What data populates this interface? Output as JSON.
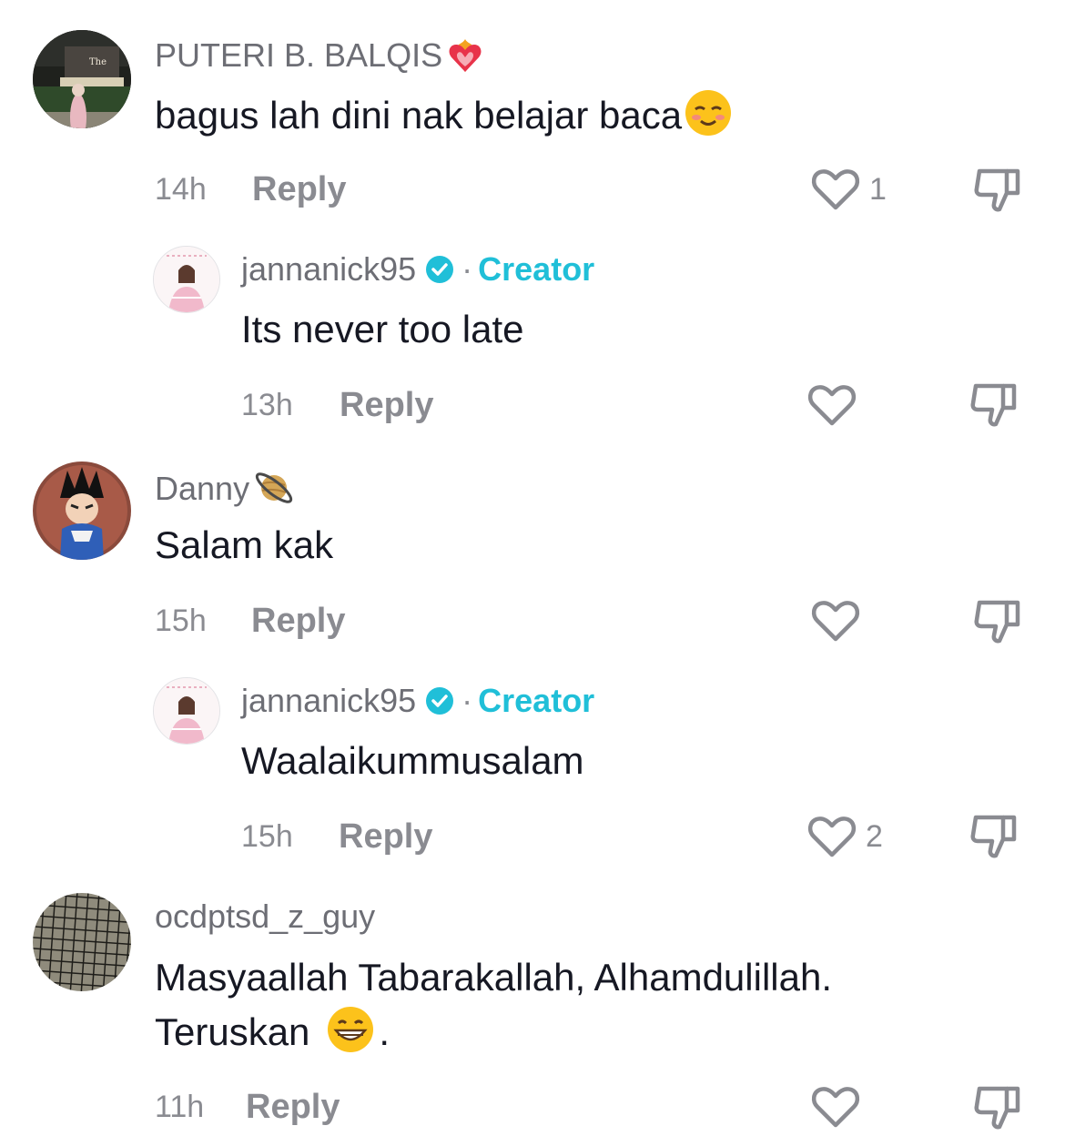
{
  "comments": [
    {
      "username": "PUTERI B. BALQIS",
      "username_emoji": "heart-on-fire-emoji",
      "text": "bagus lah dini nak belajar baca",
      "text_emoji": "smiling-face-emoji",
      "time": "14h",
      "reply_label": "Reply",
      "like_count": "1",
      "reply": {
        "username": "jannanick95",
        "separator": "·",
        "badge": "Creator",
        "text": "Its never too late",
        "time": "13h",
        "reply_label": "Reply",
        "like_count": ""
      }
    },
    {
      "username": "Danny",
      "username_emoji": "ringed-planet-emoji",
      "text": "Salam kak",
      "time": "15h",
      "reply_label": "Reply",
      "like_count": "",
      "reply": {
        "username": "jannanick95",
        "separator": "·",
        "badge": "Creator",
        "text": "Waalaikummusalam",
        "time": "15h",
        "reply_label": "Reply",
        "like_count": "2"
      }
    },
    {
      "username": "ocdptsd_z_guy",
      "text_line1": "Masyaallah Tabarakallah, Alhamdulillah.",
      "text_line2": "Teruskan",
      "text_line2_suffix": ".",
      "text_emoji": "grinning-face-emoji",
      "time": "11h",
      "reply_label": "Reply",
      "like_count": ""
    }
  ],
  "colors": {
    "text": "#161823",
    "secondary": "#8a8b91",
    "creator": "#20bfd8"
  }
}
